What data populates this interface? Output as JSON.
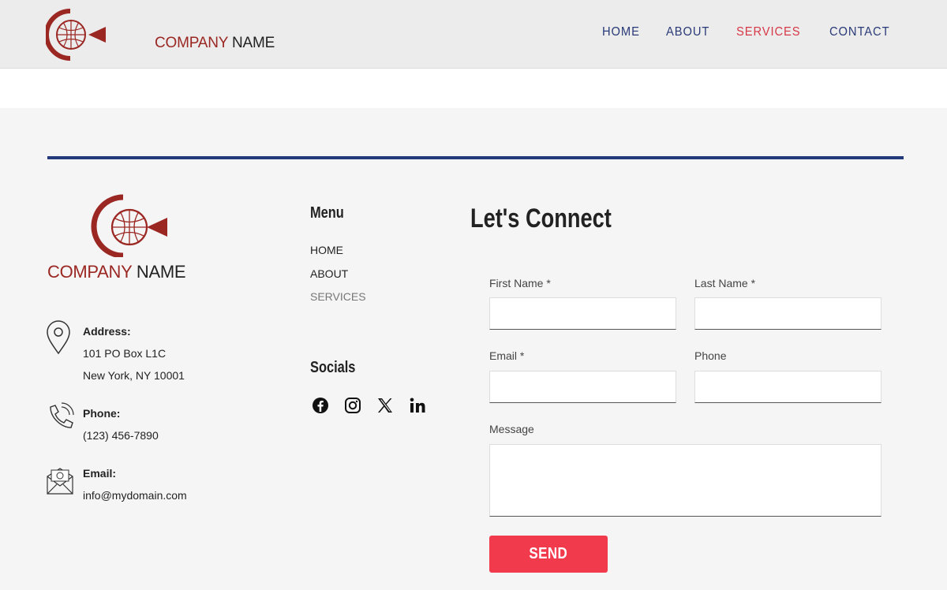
{
  "header": {
    "logo_company": "COMPANY",
    "logo_name": "NAME",
    "nav": [
      {
        "label": "HOME",
        "active": false
      },
      {
        "label": "ABOUT",
        "active": false
      },
      {
        "label": "SERVICES",
        "active": true
      },
      {
        "label": "CONTACT",
        "active": false
      }
    ]
  },
  "footer": {
    "logo_company": "COMPANY",
    "logo_name": "NAME",
    "address": {
      "label": "Address:",
      "line1": "101 PO Box L1C",
      "line2": "New York, NY 10001"
    },
    "phone": {
      "label": "Phone:",
      "value": "(123) 456-7890"
    },
    "email": {
      "label": "Email:",
      "value": "info@mydomain.com"
    },
    "menu": {
      "title": "Menu",
      "items": [
        "HOME",
        "ABOUT",
        "SERVICES"
      ]
    },
    "socials": {
      "title": "Socials",
      "icons": [
        "facebook-icon",
        "instagram-icon",
        "x-icon",
        "linkedin-icon"
      ]
    }
  },
  "form": {
    "title": "Let's Connect",
    "first_name_label": "First Name *",
    "last_name_label": "Last Name *",
    "email_label": "Email *",
    "phone_label": "Phone",
    "message_label": "Message",
    "first_name_value": "",
    "last_name_value": "",
    "email_value": "",
    "phone_value": "",
    "message_value": "",
    "send_label": "SEND"
  },
  "colors": {
    "brand_red": "#9b2723",
    "nav_blue": "#2a3a78",
    "nav_active": "#d63847",
    "rule_blue": "#22397d",
    "send_red": "#f23a4d"
  }
}
